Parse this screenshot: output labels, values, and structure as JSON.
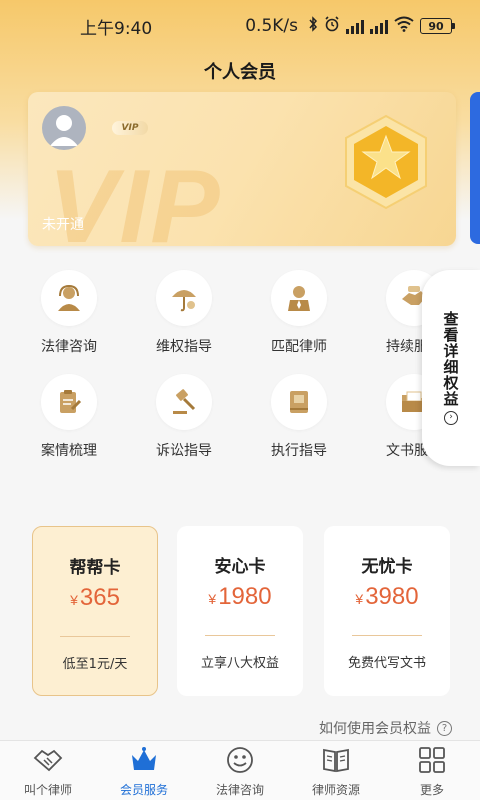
{
  "status_bar": {
    "time": "上午9:40",
    "speed": "0.5K/s",
    "battery": "90"
  },
  "header": {
    "title": "个人会员"
  },
  "vip_card": {
    "badge": "VIP",
    "watermark": "VIP",
    "status": "未开通"
  },
  "side_tab": {
    "label": "查看详细权益"
  },
  "services": [
    {
      "label": "法律咨询",
      "icon": "consultant-icon"
    },
    {
      "label": "维权指导",
      "icon": "umbrella-icon"
    },
    {
      "label": "匹配律师",
      "icon": "lawyer-icon"
    },
    {
      "label": "持续服务",
      "icon": "handshake-icon"
    },
    {
      "label": "案情梳理",
      "icon": "clipboard-icon"
    },
    {
      "label": "诉讼指导",
      "icon": "gavel-icon"
    },
    {
      "label": "执行指导",
      "icon": "book-icon"
    },
    {
      "label": "文书服务",
      "icon": "folder-icon"
    }
  ],
  "plans": [
    {
      "name": "帮帮卡",
      "currency": "¥",
      "price": "365",
      "desc": "低至1元/天",
      "selected": true
    },
    {
      "name": "安心卡",
      "currency": "¥",
      "price": "1980",
      "desc": "立享八大权益",
      "selected": false
    },
    {
      "name": "无忧卡",
      "currency": "¥",
      "price": "3980",
      "desc": "免费代写文书",
      "selected": false
    }
  ],
  "howto": {
    "label": "如何使用会员权益"
  },
  "tabbar": [
    {
      "label": "叫个律师",
      "icon": "handshake-icon",
      "active": false
    },
    {
      "label": "会员服务",
      "icon": "crown-icon",
      "active": true
    },
    {
      "label": "法律咨询",
      "icon": "smiley-icon",
      "active": false
    },
    {
      "label": "律师资源",
      "icon": "open-book-icon",
      "active": false
    },
    {
      "label": "更多",
      "icon": "grid-icon",
      "active": false
    }
  ],
  "colors": {
    "accent_gold": "#c9a063",
    "price_red": "#e3653a",
    "tab_active": "#1f6fd6"
  }
}
